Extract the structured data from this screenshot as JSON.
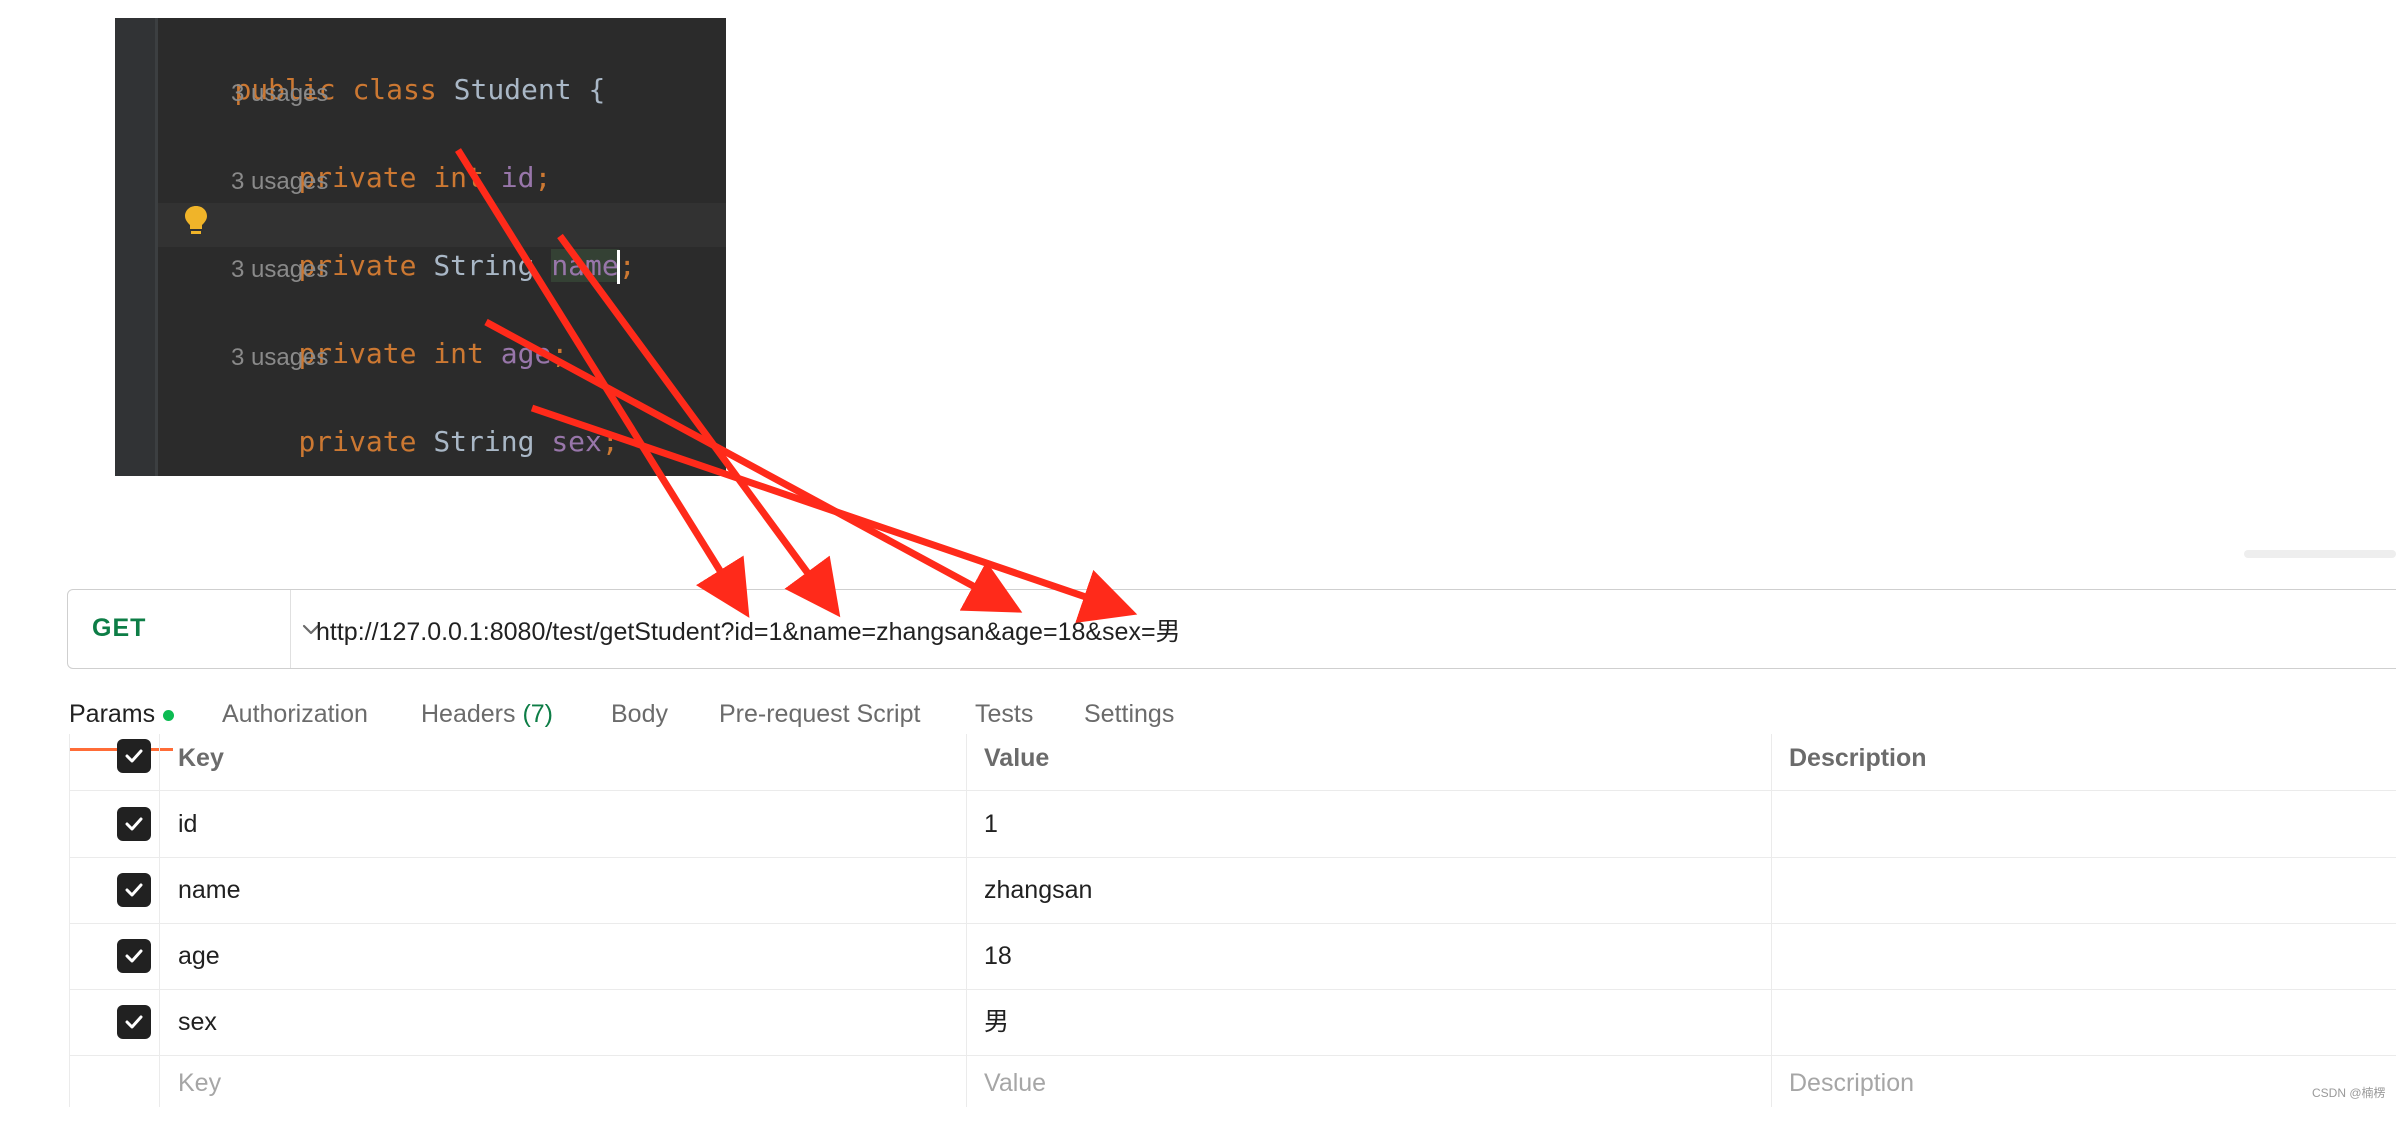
{
  "editor": {
    "class_line": {
      "kw1": "public",
      "kw2": "class",
      "name": "Student",
      "brace": "{"
    },
    "usage_hint": "3 usages",
    "fields": [
      {
        "modifier": "private",
        "type": "int",
        "name": "id",
        "end": ";"
      },
      {
        "modifier": "private",
        "type": "String",
        "name": "name",
        "end": ";"
      },
      {
        "modifier": "private",
        "type": "int",
        "name": "age",
        "end": ";"
      },
      {
        "modifier": "private",
        "type": "String",
        "name": "sex",
        "end": ";"
      }
    ]
  },
  "request": {
    "method": "GET",
    "url": "http://127.0.0.1:8080/test/getStudent?id=1&name=zhangsan&age=18&sex=男"
  },
  "tabs": [
    {
      "label": "Params"
    },
    {
      "label": "Authorization"
    },
    {
      "label": "Headers",
      "count": "(7)"
    },
    {
      "label": "Body"
    },
    {
      "label": "Pre-request Script"
    },
    {
      "label": "Tests"
    },
    {
      "label": "Settings"
    }
  ],
  "params": {
    "columns": {
      "key": "Key",
      "value": "Value",
      "description": "Description"
    },
    "rows": [
      {
        "key": "id",
        "value": "1"
      },
      {
        "key": "name",
        "value": "zhangsan"
      },
      {
        "key": "age",
        "value": "18"
      },
      {
        "key": "sex",
        "value": "男"
      }
    ],
    "placeholder": {
      "key": "Key",
      "value": "Value",
      "description": "Description"
    }
  },
  "watermark": "CSDN @楠楞",
  "colors": {
    "accent_green": "#0d7d46",
    "tab_indicator": "#ff6c37",
    "arrow": "#ff2a1a"
  }
}
